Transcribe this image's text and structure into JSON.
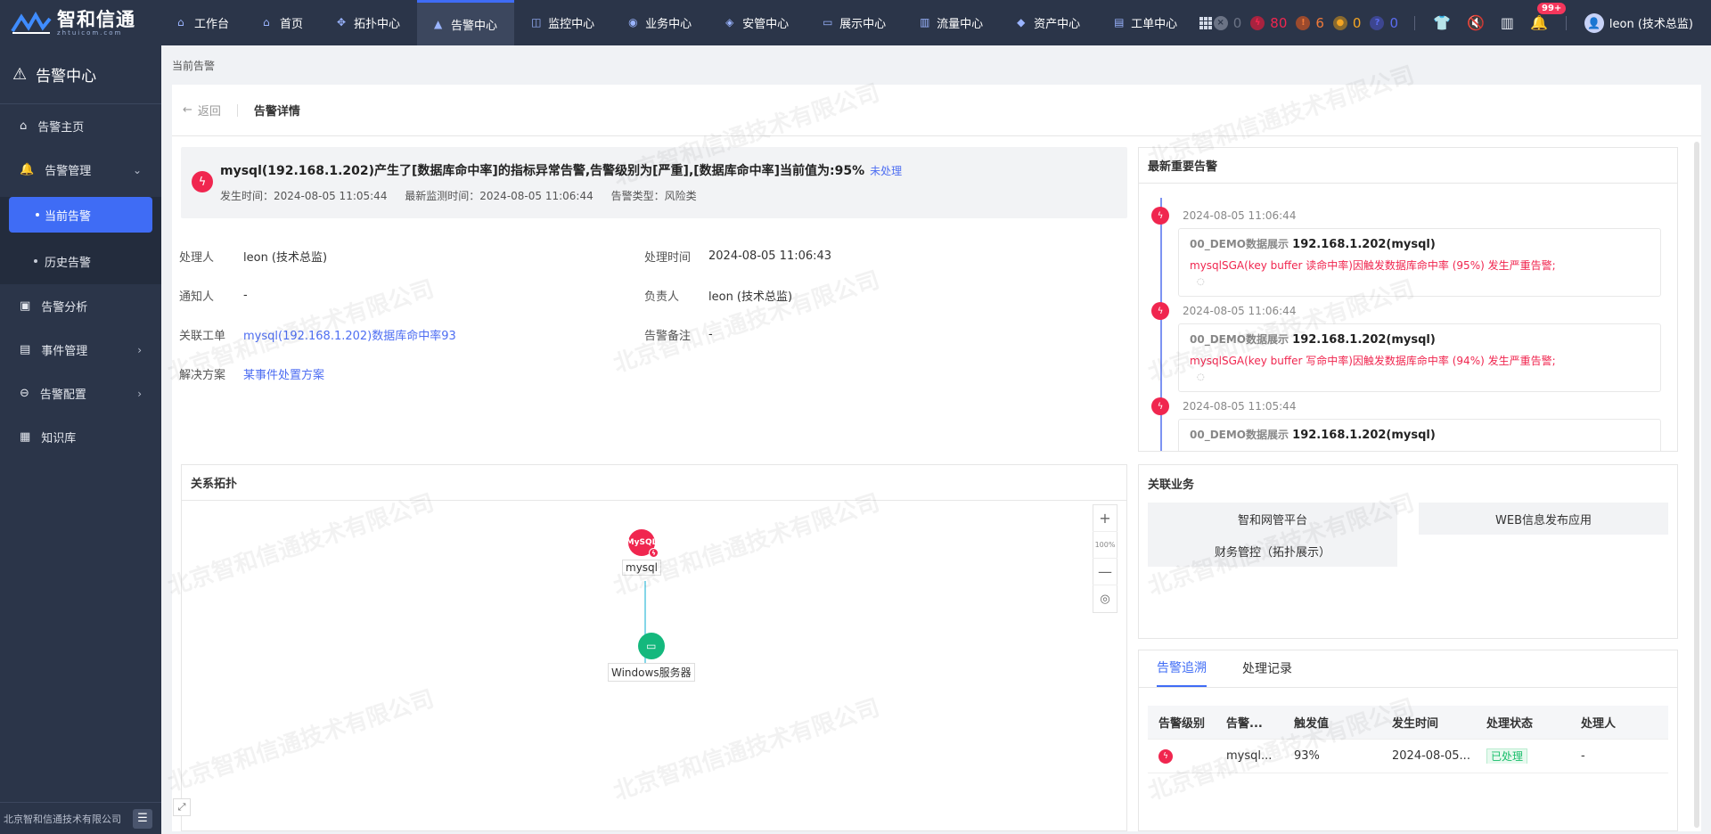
{
  "brand": {
    "name": "智和信通",
    "sub": "zhtuicom.com"
  },
  "nav": [
    {
      "label": "工作台",
      "icon": "home-icon",
      "active": false
    },
    {
      "label": "首页",
      "icon": "house-icon",
      "active": false
    },
    {
      "label": "拓扑中心",
      "icon": "topology-icon",
      "active": false
    },
    {
      "label": "告警中心",
      "icon": "alert-icon",
      "active": true
    },
    {
      "label": "监控中心",
      "icon": "monitor-icon",
      "active": false
    },
    {
      "label": "业务中心",
      "icon": "business-icon",
      "active": false
    },
    {
      "label": "安管中心",
      "icon": "shield-icon",
      "active": false
    },
    {
      "label": "展示中心",
      "icon": "display-icon",
      "active": false
    },
    {
      "label": "流量中心",
      "icon": "traffic-icon",
      "active": false
    },
    {
      "label": "资产中心",
      "icon": "asset-icon",
      "active": false
    },
    {
      "label": "工单中心",
      "icon": "ticket-icon",
      "active": false
    }
  ],
  "counters": [
    {
      "value": "0",
      "color": "#6b7385",
      "icon": "unknown-level-icon"
    },
    {
      "value": "80",
      "color": "#f0264f",
      "icon": "critical-level-icon"
    },
    {
      "value": "6",
      "color": "#f07a3a",
      "icon": "major-level-icon"
    },
    {
      "value": "0",
      "color": "#f5a623",
      "icon": "minor-level-icon"
    },
    {
      "value": "0",
      "color": "#5b6cf0",
      "icon": "info-level-icon"
    }
  ],
  "user": {
    "name": "leon (技术总监)",
    "badge": "99+"
  },
  "sidebar": {
    "title": "告警中心",
    "items": [
      {
        "label": "告警主页"
      },
      {
        "label": "告警管理"
      },
      {
        "label": "当前告警"
      },
      {
        "label": "历史告警"
      },
      {
        "label": "告警分析"
      },
      {
        "label": "事件管理"
      },
      {
        "label": "告警配置"
      },
      {
        "label": "知识库"
      }
    ],
    "footer": "北京智和信通技术有限公司"
  },
  "breadcrumb": "当前告警",
  "header": {
    "back": "返回",
    "title": "告警详情"
  },
  "alert": {
    "title": "mysql(192.168.1.202)产生了[数据库命中率]的指标异常告警,告警级别为[严重],[数据库命中率]当前值为:95%",
    "status": "未处理",
    "occur": "发生时间：2024-08-05 11:05:44",
    "latest": "最新监测时间：2024-08-05 11:06:44",
    "type": "告警类型：风险类"
  },
  "details": {
    "handler_k": "处理人",
    "handler_v": "leon (技术总监)",
    "handle_time_k": "处理时间",
    "handle_time_v": "2024-08-05 11:06:43",
    "notify_k": "通知人",
    "notify_v": "-",
    "owner_k": "负责人",
    "owner_v": "leon (技术总监)",
    "ticket_k": "关联工单",
    "ticket_v": "mysql(192.168.1.202)数据库命中率93",
    "remark_k": "告警备注",
    "remark_v": "-",
    "solution_k": "解决方案",
    "solution_v": "某事件处置方案"
  },
  "recent": {
    "title": "最新重要告警",
    "events": [
      {
        "time": "2024-08-05 11:06:44",
        "group": "00_DEMO数据展示",
        "host": "192.168.1.202(mysql)",
        "msg": "mysqlSGA(key buffer 读命中率)因触发数据库命中率 (95%) 发生严重告警;"
      },
      {
        "time": "2024-08-05 11:06:44",
        "group": "00_DEMO数据展示",
        "host": "192.168.1.202(mysql)",
        "msg": "mysqlSGA(key buffer 写命中率)因触发数据库命中率 (94%) 发生严重告警;"
      },
      {
        "time": "2024-08-05 11:05:44",
        "group": "00_DEMO数据展示",
        "host": "192.168.1.202(mysql)",
        "msg": ""
      }
    ]
  },
  "topology": {
    "title": "关系拓扑",
    "zoom": "100%",
    "nodes": [
      {
        "label": "mysql"
      },
      {
        "label": "Windows服务器"
      }
    ]
  },
  "business": {
    "title": "关联业务",
    "items": [
      "智和网管平台",
      "WEB信息发布应用",
      "财务管控（拓扑展示）"
    ]
  },
  "trace": {
    "tabs": [
      "告警追溯",
      "处理记录"
    ],
    "columns": [
      "告警级别",
      "告警...",
      "触发值",
      "发生时间",
      "处理状态",
      "处理人"
    ],
    "rows": [
      {
        "metric": "mysql...",
        "value": "93%",
        "time": "2024-08-05...",
        "status": "已处理",
        "handler": "-"
      }
    ]
  },
  "watermark": "北京智和信通技术有限公司"
}
